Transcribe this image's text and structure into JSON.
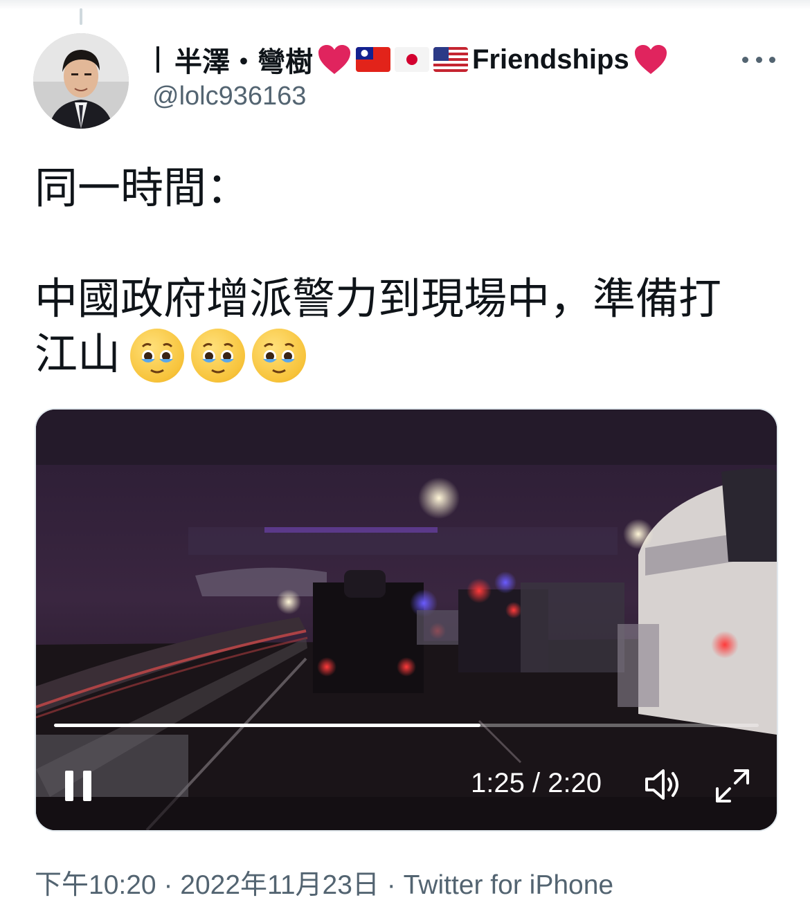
{
  "user": {
    "display_name_prefix": "半澤・彎樹",
    "display_name_suffix": "Friendships",
    "handle": "@lolc936163",
    "avatar_icon": "user-avatar-photo"
  },
  "tweet": {
    "text": "同一時間：\n\n中國政府增派警力到現場中，準備打\n江山",
    "emoji_icon": "face-holding-back-tears",
    "emoji_count": 3
  },
  "video": {
    "time_display": "1:25 / 2:20",
    "progress": 0.605,
    "pause_icon": "pause-icon",
    "volume_icon": "volume-icon",
    "fullscreen_icon": "fullscreen-icon"
  },
  "meta": {
    "time": "下午10:20",
    "date": "2022年11月23日",
    "source": "Twitter for iPhone",
    "separator": "·"
  },
  "colors": {
    "text": "#0f1419",
    "secondary": "#536471",
    "heart": "#e0245e"
  }
}
